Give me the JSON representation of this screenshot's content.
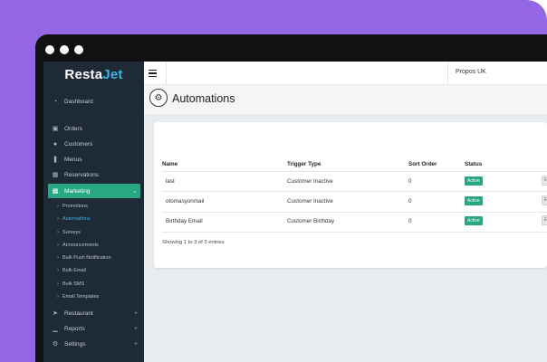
{
  "brand": {
    "part1": "Resta",
    "part2": "Jet"
  },
  "company": "Propos UK",
  "page_title": "Automations",
  "sidebar": {
    "items": [
      {
        "label": "Dashboard",
        "icon": "dashboard-icon"
      },
      {
        "label": "Orders",
        "icon": "cart-icon"
      },
      {
        "label": "Customers",
        "icon": "users-icon"
      },
      {
        "label": "Menus",
        "icon": "cutlery-icon"
      },
      {
        "label": "Reservations",
        "icon": "calendar-icon"
      },
      {
        "label": "Marketing",
        "icon": "money-icon",
        "active": true
      },
      {
        "label": "Restaurant",
        "icon": "location-arrow-icon"
      },
      {
        "label": "Reports",
        "icon": "bar-chart-icon"
      },
      {
        "label": "Settings",
        "icon": "gear-icon"
      }
    ],
    "submenu": [
      "Promotions",
      "Automations",
      "Surveys",
      "Announcements",
      "Bulk Push Notification",
      "Bulk Email",
      "Bulk SMS",
      "Email Templates"
    ]
  },
  "table": {
    "headers": [
      "Name",
      "Trigger Type",
      "Sort Order",
      "Status"
    ],
    "rows": [
      {
        "name": "last",
        "trigger": "Customer Inactive",
        "sort": "0",
        "status": "Active",
        "action": "E"
      },
      {
        "name": "otomasyonmail",
        "trigger": "Customer Inactive",
        "sort": "0",
        "status": "Active",
        "action": "E"
      },
      {
        "name": "Birthday Email",
        "trigger": "Customer Birthday",
        "sort": "0",
        "status": "Active",
        "action": "E"
      }
    ],
    "showing": "Showing 1 to 3 of 3 entries"
  },
  "colors": {
    "background": "#9467e6",
    "sidebar": "#1f2a37",
    "accent": "#28a882",
    "brand_jet": "#3fb5e4"
  }
}
